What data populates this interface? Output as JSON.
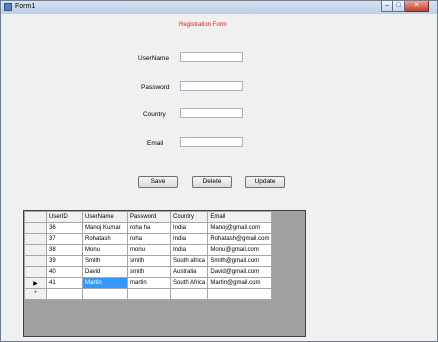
{
  "window": {
    "title": "Form1",
    "controls": {
      "minimize": "–",
      "maximize": "□",
      "close": "✕"
    }
  },
  "form": {
    "title": "Registration Form",
    "username_label": "UserName",
    "password_label": "Password",
    "country_label": "Country",
    "email_label": "Email",
    "username_value": "",
    "password_value": "",
    "country_value": "",
    "email_value": ""
  },
  "buttons": {
    "save": "Save",
    "delete": "Delete",
    "update": "Update"
  },
  "grid": {
    "columns": [
      "UserID",
      "UserName",
      "Password",
      "Country",
      "Email"
    ],
    "rows": [
      [
        "36",
        "Manoj Kumar",
        "roha ha",
        "India",
        "Manoj@gmail.com"
      ],
      [
        "37",
        "Rohatash",
        "roha",
        "India",
        "Rohatash@gmail.com"
      ],
      [
        "38",
        "Monu",
        "monu",
        "India",
        "Monu@gmail.com"
      ],
      [
        "39",
        "Smith",
        "smith",
        "South africa",
        "Smith@gmail.com"
      ],
      [
        "40",
        "David",
        "smith",
        "Australia",
        "David@gmail.com"
      ],
      [
        "41",
        "Martin",
        "martin",
        "South Africa",
        "Martin@gmail.com"
      ]
    ],
    "current_row_marker": "▶",
    "new_row_marker": "*"
  }
}
